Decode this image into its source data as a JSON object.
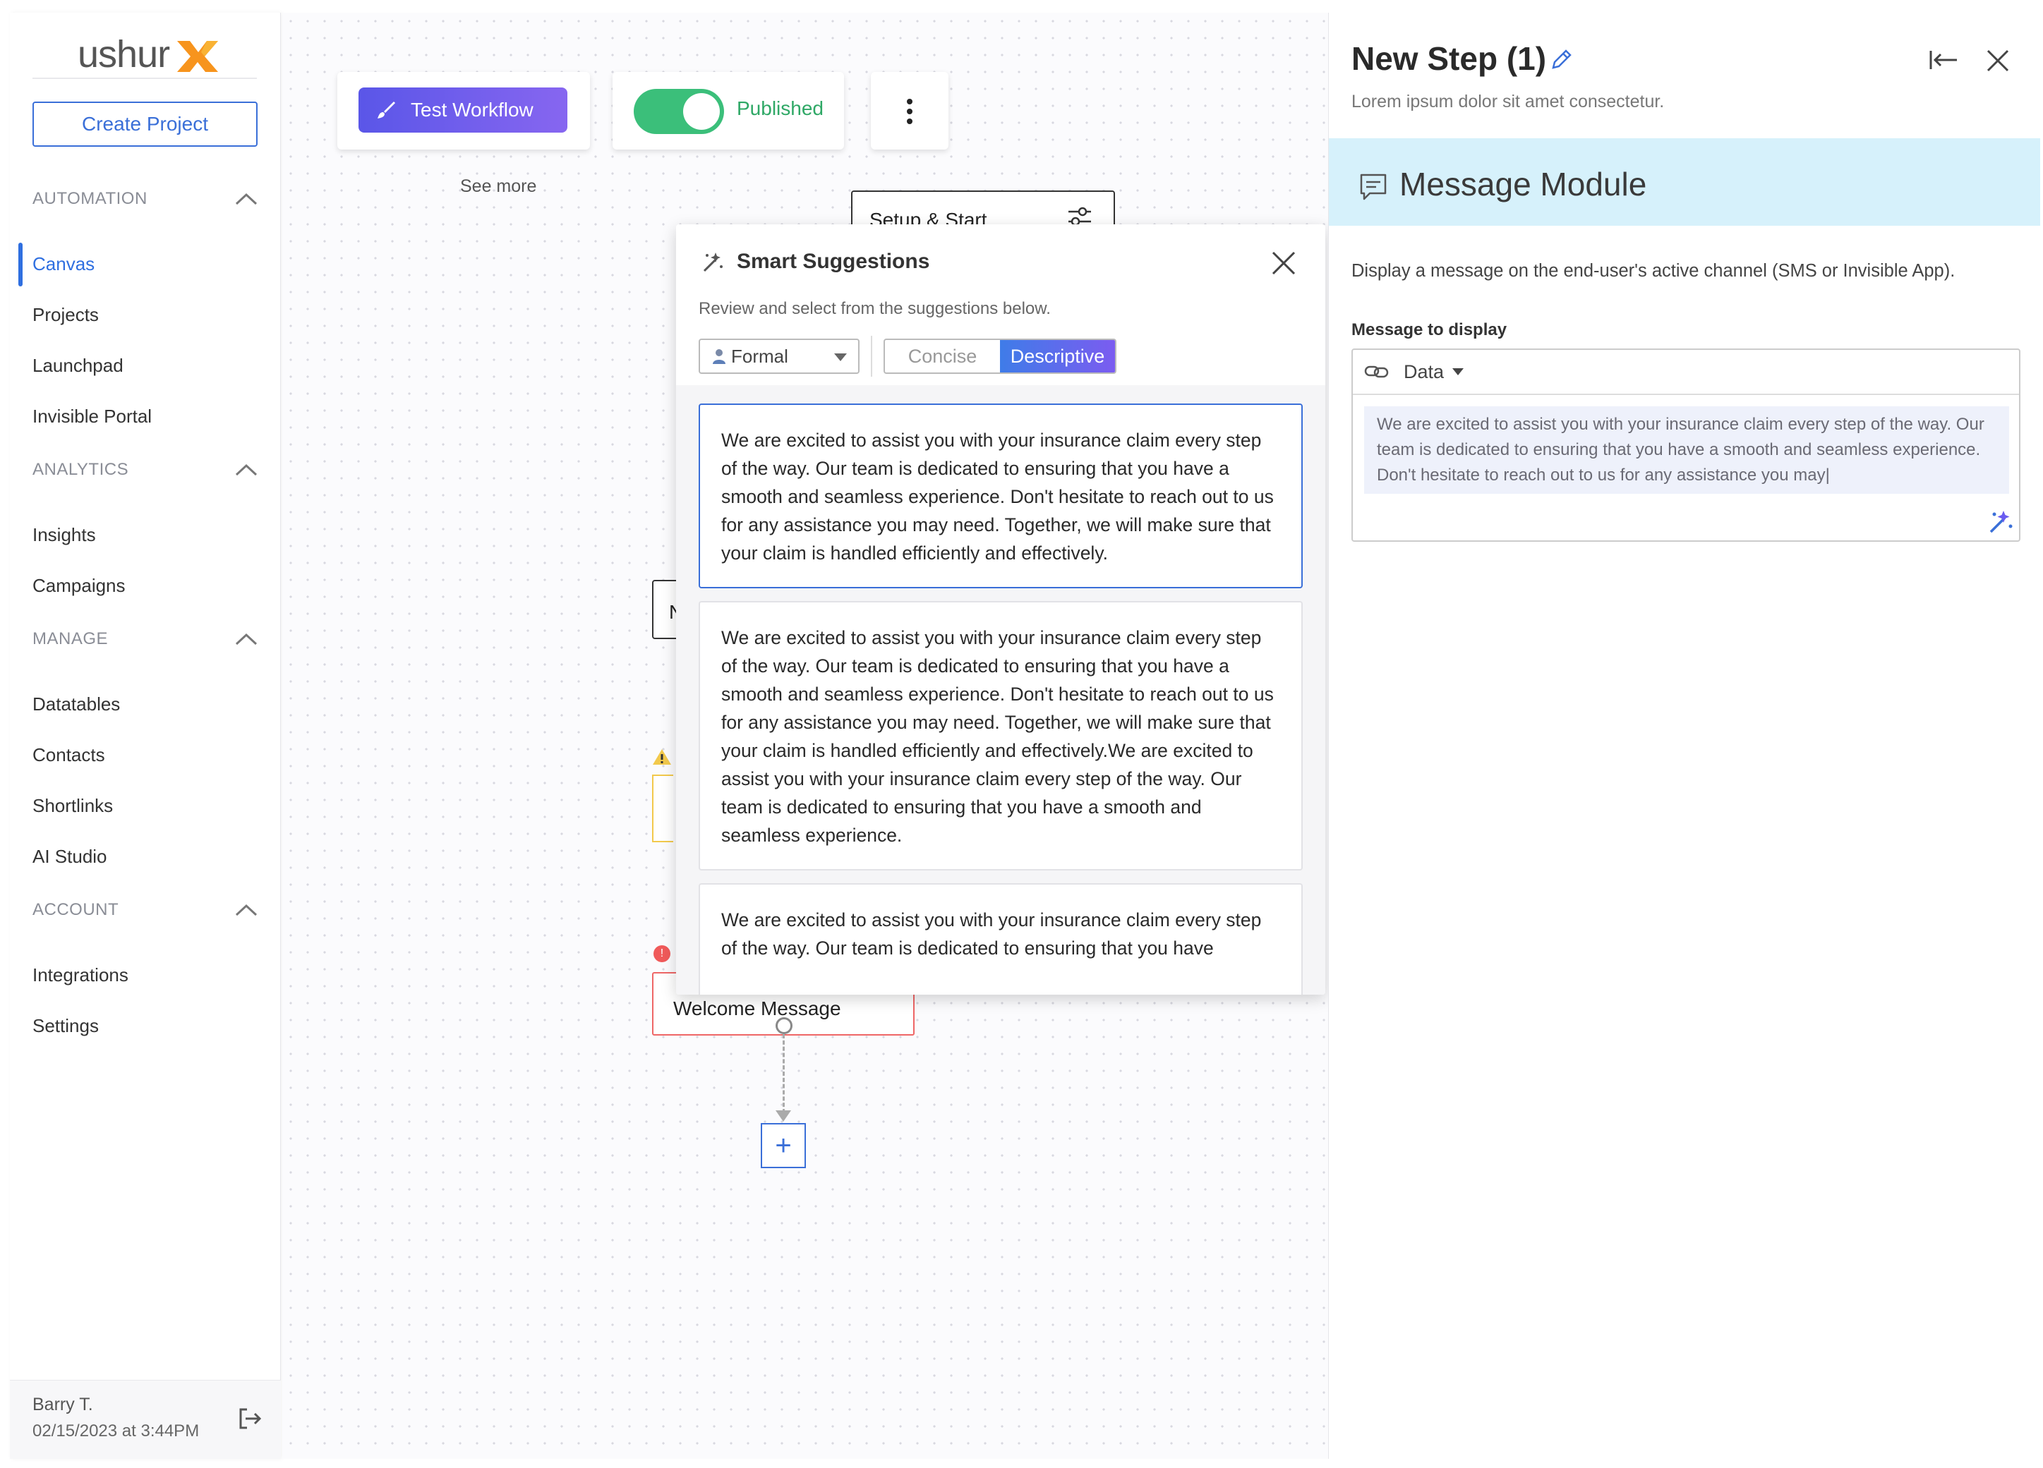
{
  "sidebar": {
    "logo": "ushur",
    "create_project": "Create Project",
    "sections": [
      {
        "title": "AUTOMATION",
        "items": [
          "Canvas",
          "Projects",
          "Launchpad",
          "Invisible Portal"
        ]
      },
      {
        "title": "ANALYTICS",
        "items": [
          "Insights",
          "Campaigns"
        ]
      },
      {
        "title": "MANAGE",
        "items": [
          "Datatables",
          "Contacts",
          "Shortlinks",
          "AI Studio"
        ]
      },
      {
        "title": "ACCOUNT",
        "items": [
          "Integrations",
          "Settings"
        ]
      }
    ],
    "active_item": "Canvas",
    "user": {
      "name": "Barry T.",
      "time": "02/15/2023 at 3:44PM"
    }
  },
  "toolbar": {
    "test_workflow": "Test Workflow",
    "published_label": "Published",
    "published": true,
    "see_more": "See more"
  },
  "canvas": {
    "setup_node": "Setup & Start",
    "welcome_node": "Welcome Message",
    "partial_node_letter": "N"
  },
  "smart_suggestions": {
    "title": "Smart Suggestions",
    "subtitle": "Review and select from the suggestions below.",
    "tone": "Formal",
    "length_options": [
      "Concise",
      "Descriptive"
    ],
    "selected_length": "Descriptive",
    "suggestions": [
      "We are excited to assist you with your insurance claim every step of the way. Our team is dedicated to ensuring that you have a smooth and seamless experience. Don't hesitate to reach out to us for any assistance you may need. Together, we will make sure that your claim is handled efficiently and effectively.",
      "We are excited to assist you with your insurance claim every step of the way. Our team is dedicated to ensuring that you have a smooth and seamless experience. Don't hesitate to reach out to us for any assistance you may need. Together, we will make sure that your claim is handled efficiently and effectively.We are excited to assist you with your insurance claim every step of the way. Our team is dedicated to ensuring that you have a smooth and seamless experience.",
      "We are excited to assist you with your insurance claim every step of the way. Our team is dedicated to ensuring that you have"
    ]
  },
  "right_panel": {
    "title": "New Step (1)",
    "description": "Lorem ipsum dolor sit amet consectetur.",
    "module_title": "Message Module",
    "info": "Display a message on the end-user's active channel (SMS or Invisible App).",
    "message_label": "Message to display",
    "data_dropdown": "Data",
    "message_text": "We are excited to assist you with your insurance claim every step of the way. Our team is dedicated to ensuring that you have a smooth and seamless experience. Don't hesitate to reach out to us for any assistance you may|"
  },
  "colors": {
    "accent_blue": "#3a6fd8",
    "published_green": "#3bbf7a",
    "module_band": "#d6f1fb",
    "logo_orange": "#f7941d"
  }
}
